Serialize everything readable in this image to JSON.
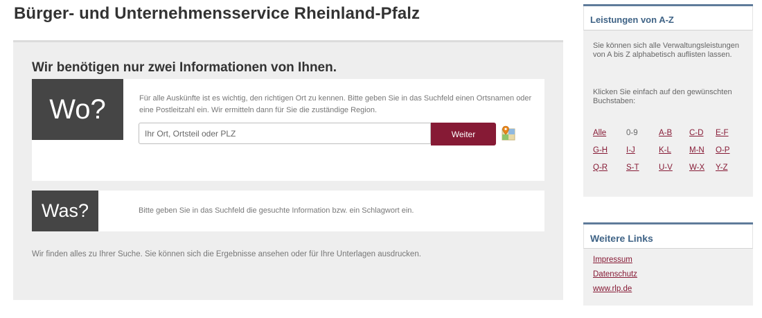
{
  "page": {
    "title": "Bürger- und Unternehmensservice Rheinland-Pfalz"
  },
  "main": {
    "intro_heading": "Wir benötigen nur zwei Informationen von Ihnen.",
    "wo": {
      "label": "Wo?",
      "description": "Für alle Auskünfte ist es wichtig, den richtigen Ort zu kennen. Bitte geben Sie in das Suchfeld einen Ortsnamen oder eine Postleitzahl ein. Wir ermitteln dann für Sie die zuständige Region.",
      "search_placeholder": "Ihr Ort, Ortsteil oder PLZ",
      "search_value": "",
      "button_label": "Weiter",
      "map_icon": "map-marker-icon"
    },
    "was": {
      "label": "Was?",
      "description": "Bitte geben Sie in das Suchfeld die gesuchte Information bzw. ein Schlagwort ein."
    },
    "footer_text": "Wir finden alles zu Ihrer Suche. Sie können sich die Ergebnisse ansehen oder für Ihre Unterlagen ausdrucken."
  },
  "sidebar": {
    "az": {
      "title": "Leistungen von A-Z",
      "text1": "Sie können sich alle Verwaltungsleistungen von A bis Z alphabetisch auflisten lassen.",
      "text2": "Klicken Sie einfach auf den gewünschten Buchstaben:",
      "letters": [
        "Alle",
        "0-9",
        "A-B",
        "C-D",
        "E-F",
        "G-H",
        "I-J",
        "K-L",
        "M-N",
        "O-P",
        "Q-R",
        "S-T",
        "U-V",
        "W-X",
        "Y-Z"
      ]
    },
    "links": {
      "title": "Weitere Links",
      "items": [
        "Impressum",
        "Datenschutz",
        "www.rlp.de"
      ]
    }
  },
  "colors": {
    "accent": "#861a35",
    "sidebar_header_text": "#3f6386",
    "sidebar_border": "#5f7b9a",
    "label_block": "#454545"
  }
}
